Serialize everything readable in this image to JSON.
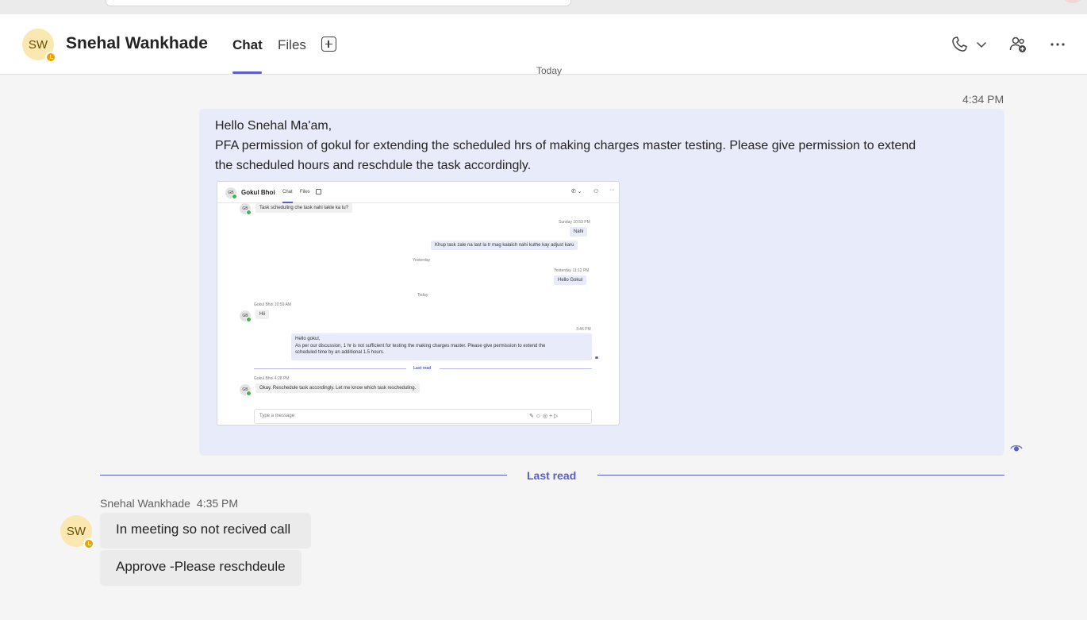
{
  "header": {
    "avatar_initials": "SW",
    "name": "Snehal Wankhade",
    "tabs": [
      {
        "label": "Chat",
        "active": true
      },
      {
        "label": "Files",
        "active": false
      }
    ],
    "icons": [
      "add-tab-icon",
      "phone-icon",
      "chevron-down-icon",
      "add-people-icon",
      "more-options-icon"
    ]
  },
  "conversation": {
    "date_separator": "Today",
    "my_message": {
      "time": "4:34 PM",
      "lines": [
        "Hello Snehal Ma'am,",
        "PFA permission of gokul for extending the scheduled hrs of making charges master testing. Please give permission to extend",
        "the scheduled hours and reschdule the task accordingly."
      ]
    },
    "last_read": "Last read",
    "reply": {
      "sender": "Snehal Wankhade",
      "time": "4:35 PM",
      "avatar_initials": "SW",
      "messages": [
        "In meeting so not recived call",
        "Approve -Please reschdeule"
      ]
    }
  },
  "attached_screenshot": {
    "avatar_initials": "GB",
    "name": "Gokul Bhoi",
    "tabs": [
      "Chat",
      "Files"
    ],
    "top_message": "Task scheduling che task nahi takle ka tu?",
    "time_sunday": "Sunday 10:53 PM",
    "msg_nahi": "Nahi",
    "msg_khup": "Khup task zale na last la tr mag kalalch nahi kuthe kay adjust karu",
    "sep_yesterday": "Yesterday",
    "time_yesterday": "Yesterday 11:12 PM",
    "msg_hello_gokul": "Hello Gokul",
    "sep_today": "Today",
    "gokul_meta_1": "Gokul Bhoi   10:59 AM",
    "msg_hi": "Hii",
    "time_346": "3:46 PM",
    "msg_long_lines": [
      "Hello gokul,",
      "As per our discussion, 1 hr is not sufficient for testing the making charges master. Please give permission to extend the",
      "scheduled time by an additional 1.5 hours."
    ],
    "last_read": "Last read",
    "gokul_meta_2": "Gokul Bhoi   4:28 PM",
    "msg_okay": "Okay. Reschedule task accordingly. Let me know which task rescheduling.",
    "input_placeholder": "Type a message"
  }
}
